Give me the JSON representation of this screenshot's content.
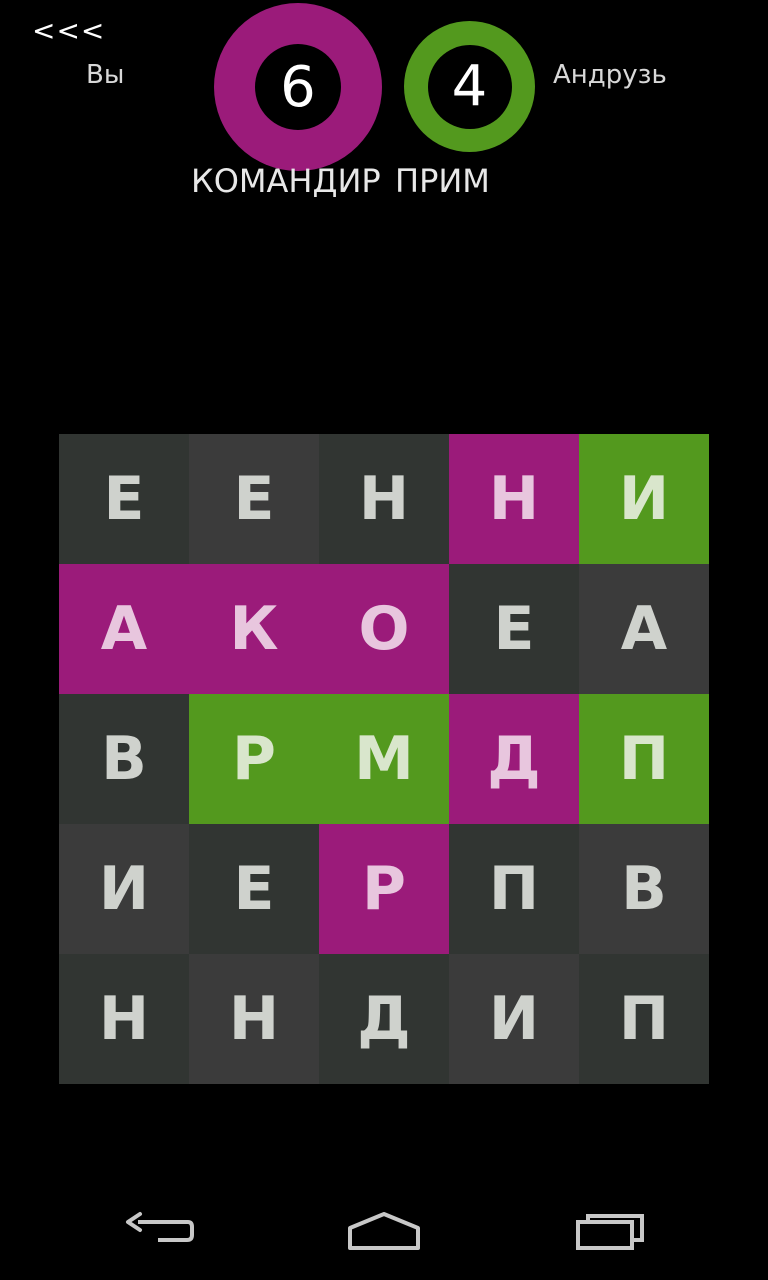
{
  "header": {
    "back_label": "<<<",
    "you": {
      "name": "Вы",
      "score": "6",
      "word": "КОМАНДИР",
      "color": "#9b1b7a"
    },
    "opponent": {
      "name": "Андрузь",
      "score": "4",
      "word": "ПРИМ",
      "color": "#53991e"
    }
  },
  "colors": {
    "you": "#9b1b7a",
    "opponent": "#53991e",
    "neutral_dark": "#313532",
    "neutral_light": "#3b3b3b"
  },
  "board": {
    "rows": [
      [
        {
          "letter": "Е",
          "owner": "none"
        },
        {
          "letter": "Е",
          "owner": "none"
        },
        {
          "letter": "Н",
          "owner": "none"
        },
        {
          "letter": "Н",
          "owner": "you"
        },
        {
          "letter": "И",
          "owner": "opponent"
        }
      ],
      [
        {
          "letter": "А",
          "owner": "you"
        },
        {
          "letter": "К",
          "owner": "you"
        },
        {
          "letter": "О",
          "owner": "you"
        },
        {
          "letter": "Е",
          "owner": "none"
        },
        {
          "letter": "А",
          "owner": "none"
        }
      ],
      [
        {
          "letter": "В",
          "owner": "none"
        },
        {
          "letter": "Р",
          "owner": "opponent"
        },
        {
          "letter": "М",
          "owner": "opponent"
        },
        {
          "letter": "Д",
          "owner": "you"
        },
        {
          "letter": "П",
          "owner": "opponent"
        }
      ],
      [
        {
          "letter": "И",
          "owner": "none"
        },
        {
          "letter": "Е",
          "owner": "none"
        },
        {
          "letter": "Р",
          "owner": "you"
        },
        {
          "letter": "П",
          "owner": "none"
        },
        {
          "letter": "В",
          "owner": "none"
        }
      ],
      [
        {
          "letter": "Н",
          "owner": "none"
        },
        {
          "letter": "Н",
          "owner": "none"
        },
        {
          "letter": "Д",
          "owner": "none"
        },
        {
          "letter": "И",
          "owner": "none"
        },
        {
          "letter": "П",
          "owner": "none"
        }
      ]
    ]
  },
  "navbar": {
    "back_icon": "back-arrow-icon",
    "home_icon": "home-icon",
    "recent_icon": "recent-apps-icon"
  }
}
